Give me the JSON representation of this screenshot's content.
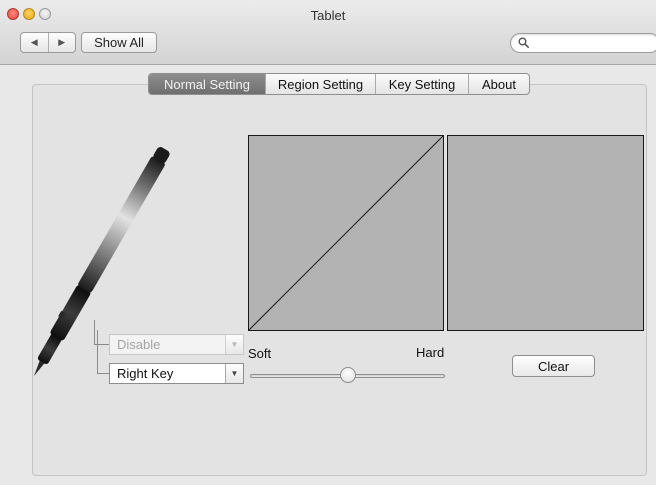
{
  "window": {
    "title": "Tablet"
  },
  "toolbar": {
    "nav_back_icon": "triangle-left-icon",
    "nav_forward_icon": "triangle-right-icon",
    "show_all_label": "Show All",
    "search": {
      "value": "",
      "placeholder": ""
    }
  },
  "tabs": [
    {
      "label": "Normal Setting",
      "selected": true
    },
    {
      "label": "Region Setting",
      "selected": false
    },
    {
      "label": "Key Setting",
      "selected": false
    },
    {
      "label": "About",
      "selected": false
    }
  ],
  "pen_buttons": {
    "upper": {
      "value": "Disable",
      "enabled": false
    },
    "lower": {
      "value": "Right Key",
      "enabled": true
    }
  },
  "pressure": {
    "soft_label": "Soft",
    "hard_label": "Hard",
    "slider_fraction": 0.5
  },
  "clear_label": "Clear",
  "colors": {
    "active_tab": "#7c7c7c",
    "graph_fill": "#b3b3b3",
    "close": "#e0443b",
    "minimize": "#e5a50d"
  }
}
